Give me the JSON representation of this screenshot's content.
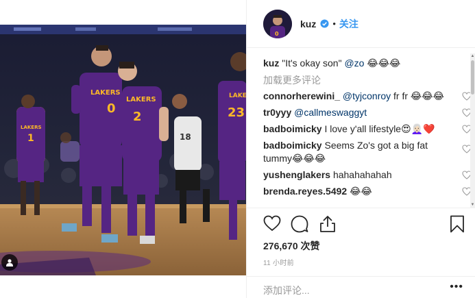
{
  "post": {
    "username": "kuz",
    "follow_label": "关注",
    "dot": "•",
    "caption": {
      "username": "kuz",
      "text": "\"It's okay son\"",
      "mention": "@zo",
      "emojis": "😂😂😂"
    },
    "load_more": "加载更多评论",
    "comments": [
      {
        "user": "connorherewini_",
        "mention": "@tyjconroy",
        "text": "fr fr 😂😂😂"
      },
      {
        "user": "tr0yyy",
        "mention": "@callmeswaggyt",
        "text": ""
      },
      {
        "user": "badboimicky",
        "mention": "",
        "text": "I love y'all lifestyle😍👩🏻‍🦳❤️"
      },
      {
        "user": "badboimicky",
        "mention": "",
        "text": "Seems Zo's got a big fat tummy😂😂😂"
      },
      {
        "user": "yushenglakers",
        "mention": "",
        "text": "hahahahahah"
      },
      {
        "user": "brenda.reyes.5492",
        "mention": "",
        "text": "😂😂"
      }
    ],
    "likes": "276,670 次赞",
    "time": "11 小时前",
    "add_comment_placeholder": "添加评论...",
    "more": "•••"
  },
  "colors": {
    "link": "#3897f0",
    "mention": "#003569",
    "lakers_purple": "#552583",
    "lakers_gold": "#fdb927"
  }
}
